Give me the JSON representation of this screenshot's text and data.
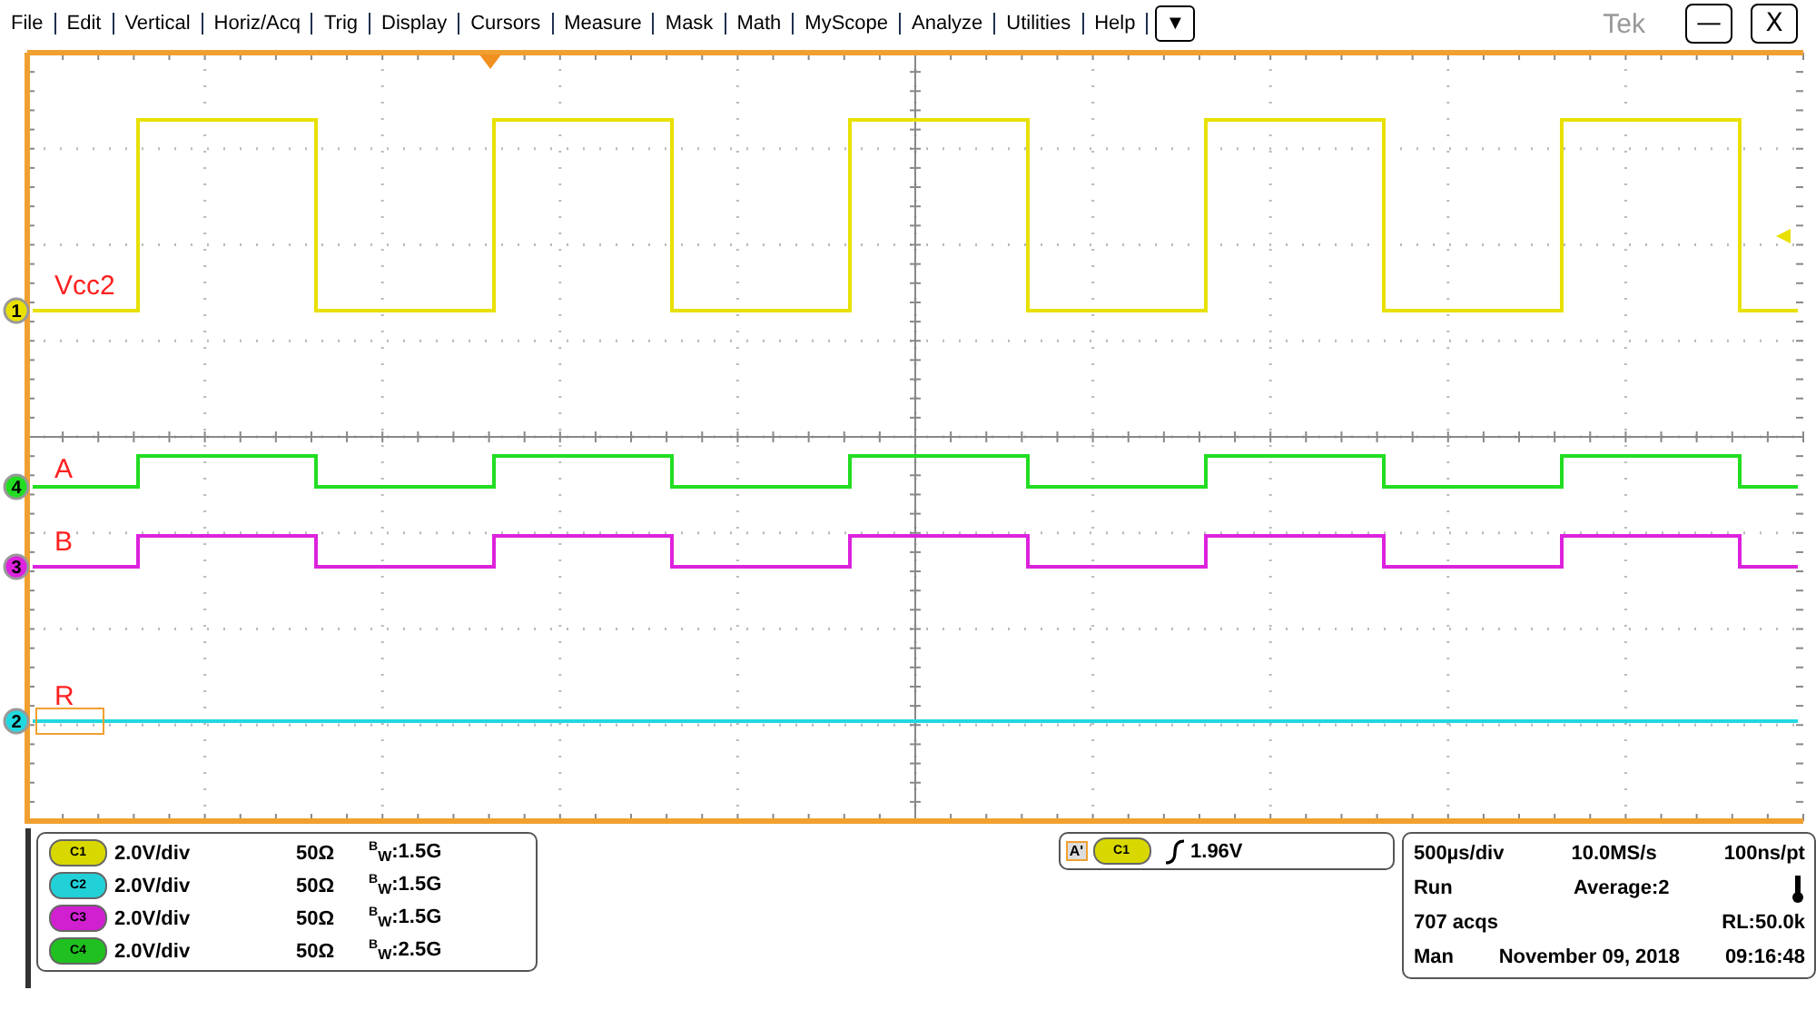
{
  "menu": [
    "File",
    "Edit",
    "Vertical",
    "Horiz/Acq",
    "Trig",
    "Display",
    "Cursors",
    "Measure",
    "Mask",
    "Math",
    "MyScope",
    "Analyze",
    "Utilities",
    "Help"
  ],
  "menu_more": "▼",
  "brand": "Tek",
  "window_buttons": [
    "—",
    "X"
  ],
  "traces": [
    {
      "marker": "1",
      "label": "Vcc2",
      "color": "#e8e000",
      "kind": "square"
    },
    {
      "marker": "4",
      "label": "A",
      "color": "#22dd22",
      "kind": "square"
    },
    {
      "marker": "3",
      "label": "B",
      "color": "#dd22dd",
      "kind": "square"
    },
    {
      "marker": "2",
      "label": "R",
      "color": "#22d8e0",
      "kind": "flat"
    }
  ],
  "channel_readouts": [
    {
      "badge": "C1",
      "color": "#d8d800",
      "scale": "2.0V/div",
      "impedance": "50Ω",
      "bandwidth": "$^{B}$$_{W}$:1.5G"
    },
    {
      "badge": "C2",
      "color": "#22d0d8",
      "scale": "2.0V/div",
      "impedance": "50Ω",
      "bandwidth": "$^{B}$$_{W}$:1.5G"
    },
    {
      "badge": "C3",
      "color": "#d020d0",
      "scale": "2.0V/div",
      "impedance": "50Ω",
      "bandwidth": "$^{B}$$_{W}$:1.5G"
    },
    {
      "badge": "C4",
      "color": "#20c020",
      "scale": "2.0V/div",
      "impedance": "50Ω",
      "bandwidth": "$^{B}$$_{W}$:2.5G"
    }
  ],
  "trigger": {
    "tag": "A'",
    "badge": "C1",
    "color": "#d8d800",
    "level": "1.96V"
  },
  "acquisition": [
    [
      "500µs/div",
      "10.0MS/s",
      "100ns/pt"
    ],
    [
      "Run",
      "Average:2"
    ],
    [
      "707 acqs",
      "RL:50.0k"
    ],
    [
      "Man",
      "November 09, 2018",
      "09:16:48"
    ]
  ]
}
